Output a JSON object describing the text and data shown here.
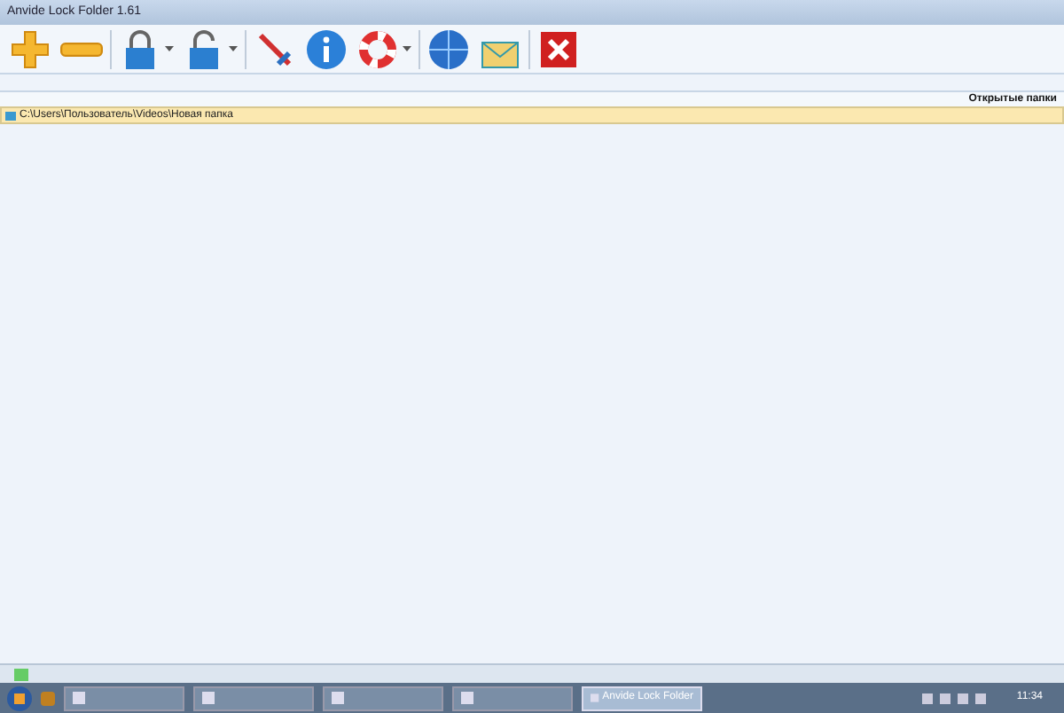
{
  "window": {
    "title": "Anvide Lock Folder 1.61"
  },
  "toolbar": [
    {
      "kind": "add"
    },
    {
      "kind": "remove"
    },
    {
      "kind": "lock",
      "dropdown": true
    },
    {
      "kind": "unlock",
      "dropdown": true
    },
    {
      "kind": "settings"
    },
    {
      "kind": "info"
    },
    {
      "kind": "help",
      "dropdown": true
    },
    {
      "kind": "web"
    },
    {
      "kind": "mail"
    },
    {
      "kind": "exit"
    }
  ],
  "list": {
    "header": "Открытые папки",
    "rows": [
      {
        "path": "C:\\Users\\Пользователь\\Videos\\Новая папка",
        "selected": true
      }
    ]
  },
  "taskbar": {
    "items": [
      {
        "selected": false
      },
      {
        "selected": false
      },
      {
        "selected": false
      },
      {
        "selected": false
      },
      {
        "label": "Anvide Lock Folder",
        "selected": true
      }
    ],
    "clock": "11:34"
  }
}
